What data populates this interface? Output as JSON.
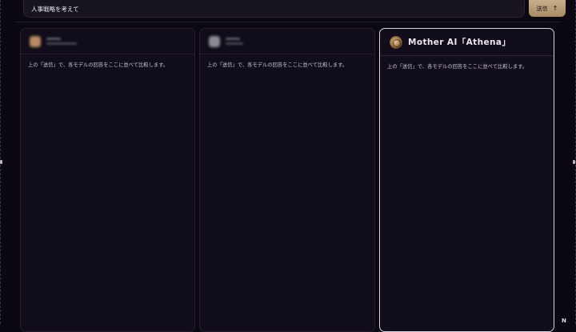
{
  "prompt": {
    "value": "人事戦略を考えて"
  },
  "send_button": {
    "label": "送信",
    "icon": "arrow-up-icon"
  },
  "panels": [
    {
      "title": "",
      "avatar_color": "#b98a66",
      "body": "上の「送信」で、各モデルの回答をここに並べて比較します。"
    },
    {
      "title": "",
      "avatar_color": "#8d8a93",
      "body": "上の「送信」で、各モデルの回答をここに並べて比較します。"
    },
    {
      "title": "Mother AI「Athena」",
      "icon": "athena-logo-icon",
      "body": "上の「送信」で、各モデルの回答をここに並べて比較します。"
    }
  ],
  "colors": {
    "background": "#0b0812",
    "accent_button": "#c8ae8b",
    "selected_border": "#d6d2de"
  }
}
